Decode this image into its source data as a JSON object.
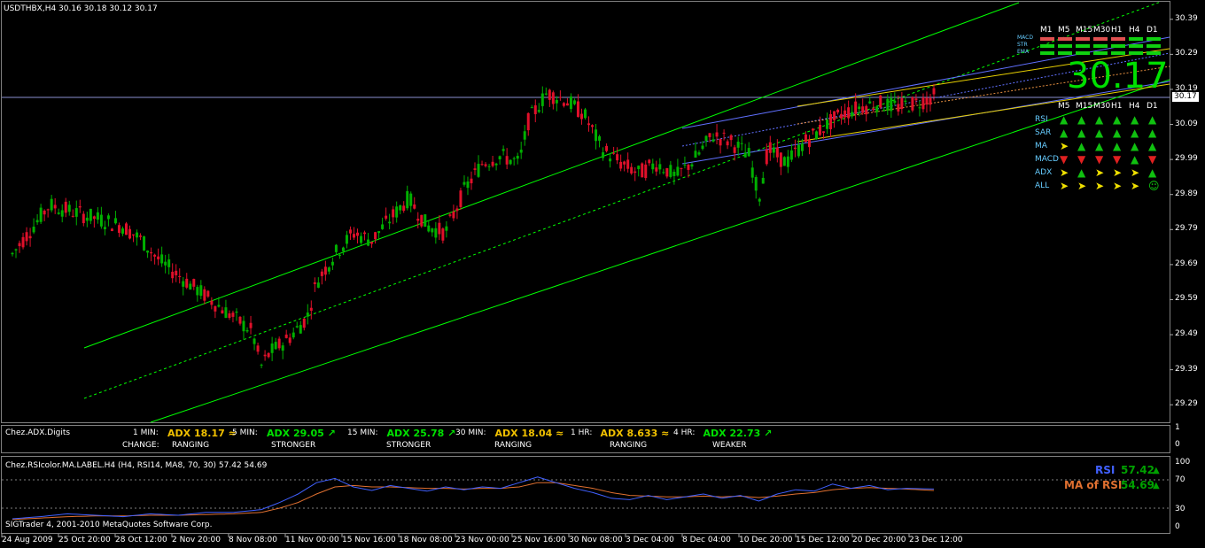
{
  "header": {
    "title": "USDTHBX,H4  30.16 30.18 30.12 30.17"
  },
  "colors": {
    "bull": "#00b000",
    "bear": "#e0102a",
    "channel": "#00ff00",
    "blue": "#6070ff",
    "yellow": "#e8d000",
    "orange": "#e89040",
    "hline": "#8a90d0"
  },
  "chart_data": [
    {
      "type": "line",
      "name": "USDTHBX H4 price",
      "ylim": [
        29.24,
        30.44
      ],
      "y_ticks": [
        "30.39",
        "30.29",
        "30.19",
        "30.09",
        "29.99",
        "29.89",
        "29.79",
        "29.69",
        "29.59",
        "29.49",
        "29.39",
        "29.29"
      ],
      "current_price": "30.17",
      "big_price": "30.17",
      "x_labels": [
        "24 Aug 2009",
        "25 Oct 20:00",
        "28 Oct 12:00",
        "2 Nov 20:00",
        "8 Nov 08:00",
        "11 Nov 00:00",
        "15 Nov 16:00",
        "18 Nov 08:00",
        "23 Nov 00:00",
        "25 Nov 16:00",
        "30 Nov 08:00",
        "3 Dec 04:00",
        "8 Dec 04:00",
        "10 Dec 20:00",
        "15 Dec 12:00",
        "20 Dec 20:00",
        "23 Dec 12:00"
      ],
      "close_path": [
        [
          0,
          29.72
        ],
        [
          4,
          29.86
        ],
        [
          8,
          29.83
        ],
        [
          12,
          29.8
        ],
        [
          14,
          29.76
        ],
        [
          16,
          29.7
        ],
        [
          18,
          29.66
        ],
        [
          20,
          29.62
        ],
        [
          22,
          29.58
        ],
        [
          24,
          29.54
        ],
        [
          26,
          29.5
        ],
        [
          27,
          29.4
        ],
        [
          28,
          29.44
        ],
        [
          30,
          29.48
        ],
        [
          32,
          29.54
        ],
        [
          33,
          29.64
        ],
        [
          35,
          29.72
        ],
        [
          37,
          29.78
        ],
        [
          39,
          29.76
        ],
        [
          41,
          29.82
        ],
        [
          43,
          29.88
        ],
        [
          45,
          29.8
        ],
        [
          47,
          29.78
        ],
        [
          49,
          29.9
        ],
        [
          51,
          29.98
        ],
        [
          53,
          30.0
        ],
        [
          55,
          29.98
        ],
        [
          56,
          30.1
        ],
        [
          58,
          30.18
        ],
        [
          60,
          30.16
        ],
        [
          62,
          30.12
        ],
        [
          64,
          30.02
        ],
        [
          66,
          29.98
        ],
        [
          68,
          29.95
        ],
        [
          70,
          29.98
        ],
        [
          72,
          29.94
        ],
        [
          74,
          29.99
        ],
        [
          76,
          30.06
        ],
        [
          78,
          30.04
        ],
        [
          80,
          30.0
        ],
        [
          81,
          29.88
        ],
        [
          82,
          30.02
        ],
        [
          84,
          29.98
        ],
        [
          86,
          30.04
        ],
        [
          88,
          30.08
        ],
        [
          90,
          30.12
        ],
        [
          92,
          30.14
        ],
        [
          94,
          30.15
        ],
        [
          96,
          30.14
        ],
        [
          98,
          30.15
        ],
        [
          100,
          30.17
        ]
      ],
      "indicator_panel_1": {
        "name": "Chez.ADX.Digits",
        "change_label": "CHANGE:",
        "items": [
          {
            "tf": "1 MIN:",
            "adx": "ADX 18.17",
            "arrow": "≈",
            "status": "RANGING",
            "color": "#f0c000"
          },
          {
            "tf": "5 MIN:",
            "adx": "ADX 29.05",
            "arrow": "↗",
            "status": "STRONGER",
            "color": "#00e000"
          },
          {
            "tf": "15 MIN:",
            "adx": "ADX 25.78",
            "arrow": "↗",
            "status": "STRONGER",
            "color": "#00e000"
          },
          {
            "tf": "30 MIN:",
            "adx": "ADX 18.04",
            "arrow": "≈",
            "status": "RANGING",
            "color": "#f0c000"
          },
          {
            "tf": "1 HR:",
            "adx": "ADX 8.633",
            "arrow": "≈",
            "status": "RANGING",
            "color": "#f0c000"
          },
          {
            "tf": "4 HR:",
            "adx": "ADX 22.73",
            "arrow": "↗",
            "status": "WEAKER",
            "color": "#00e000"
          }
        ],
        "y_ticks": [
          "1",
          "0"
        ]
      },
      "indicator_panel_2": {
        "name": "Chez.RSIcolor.MA.LABEL.H4 (H4, RSI14, MA8, 70, 30) 57.42 54.69",
        "rsi_label": "RSI",
        "rsi_value": "57.42",
        "ma_label": "MA of RSI",
        "ma_value": "54.69",
        "y_ticks": [
          "100",
          "70",
          "30",
          "0"
        ],
        "levels": [
          70,
          30
        ],
        "copyright": "SIGTrader 4, 2001-2010 MetaQuotes Software Corp.",
        "rsi_path": [
          [
            0,
            15
          ],
          [
            3,
            18
          ],
          [
            6,
            22
          ],
          [
            9,
            20
          ],
          [
            12,
            18
          ],
          [
            15,
            22
          ],
          [
            18,
            20
          ],
          [
            21,
            24
          ],
          [
            24,
            24
          ],
          [
            27,
            28
          ],
          [
            29,
            38
          ],
          [
            31,
            50
          ],
          [
            33,
            66
          ],
          [
            35,
            72
          ],
          [
            37,
            60
          ],
          [
            39,
            55
          ],
          [
            41,
            62
          ],
          [
            43,
            58
          ],
          [
            45,
            54
          ],
          [
            47,
            60
          ],
          [
            49,
            56
          ],
          [
            51,
            60
          ],
          [
            53,
            58
          ],
          [
            55,
            66
          ],
          [
            57,
            74
          ],
          [
            59,
            66
          ],
          [
            61,
            58
          ],
          [
            63,
            52
          ],
          [
            65,
            44
          ],
          [
            67,
            42
          ],
          [
            69,
            48
          ],
          [
            71,
            42
          ],
          [
            73,
            46
          ],
          [
            75,
            50
          ],
          [
            77,
            44
          ],
          [
            79,
            48
          ],
          [
            81,
            40
          ],
          [
            83,
            50
          ],
          [
            85,
            56
          ],
          [
            87,
            54
          ],
          [
            89,
            64
          ],
          [
            91,
            58
          ],
          [
            93,
            62
          ],
          [
            95,
            56
          ],
          [
            97,
            58
          ],
          [
            100,
            57
          ]
        ],
        "ma_path": [
          [
            0,
            14
          ],
          [
            3,
            16
          ],
          [
            6,
            18
          ],
          [
            9,
            19
          ],
          [
            12,
            19
          ],
          [
            15,
            20
          ],
          [
            18,
            20
          ],
          [
            21,
            21
          ],
          [
            24,
            22
          ],
          [
            27,
            24
          ],
          [
            29,
            30
          ],
          [
            31,
            38
          ],
          [
            33,
            50
          ],
          [
            35,
            60
          ],
          [
            37,
            62
          ],
          [
            39,
            60
          ],
          [
            41,
            60
          ],
          [
            43,
            59
          ],
          [
            45,
            58
          ],
          [
            47,
            58
          ],
          [
            49,
            57
          ],
          [
            51,
            58
          ],
          [
            53,
            58
          ],
          [
            55,
            60
          ],
          [
            57,
            66
          ],
          [
            59,
            66
          ],
          [
            61,
            62
          ],
          [
            63,
            58
          ],
          [
            65,
            52
          ],
          [
            67,
            48
          ],
          [
            69,
            47
          ],
          [
            71,
            46
          ],
          [
            73,
            46
          ],
          [
            75,
            47
          ],
          [
            77,
            46
          ],
          [
            79,
            47
          ],
          [
            81,
            45
          ],
          [
            83,
            47
          ],
          [
            85,
            50
          ],
          [
            87,
            52
          ],
          [
            89,
            56
          ],
          [
            91,
            58
          ],
          [
            93,
            59
          ],
          [
            95,
            58
          ],
          [
            97,
            57
          ],
          [
            100,
            55
          ]
        ]
      }
    }
  ],
  "overlay": {
    "tf_top": [
      "M1",
      "M5",
      "M15",
      "M30",
      "H1",
      "H4",
      "D1"
    ],
    "row_labels_top": [
      "MACD",
      "STR",
      "EMA"
    ],
    "tf_bottom": [
      "M5",
      "M15",
      "M30",
      "H1",
      "H4",
      "D1"
    ],
    "rows": [
      {
        "label": "RSI",
        "arrows": [
          "up",
          "up",
          "up",
          "up",
          "up",
          "up"
        ]
      },
      {
        "label": "SAR",
        "arrows": [
          "up",
          "up",
          "up",
          "up",
          "up",
          "up"
        ]
      },
      {
        "label": "MA",
        "arrows": [
          "right",
          "up",
          "up",
          "up",
          "up",
          "up"
        ]
      },
      {
        "label": "MACD",
        "arrows": [
          "down",
          "down",
          "down",
          "down",
          "up",
          "down"
        ]
      },
      {
        "label": "ADX",
        "arrows": [
          "right",
          "up",
          "right",
          "right",
          "right",
          "up"
        ]
      },
      {
        "label": "ALL",
        "arrows": [
          "right",
          "right",
          "right",
          "right",
          "right",
          "smile"
        ]
      }
    ]
  }
}
